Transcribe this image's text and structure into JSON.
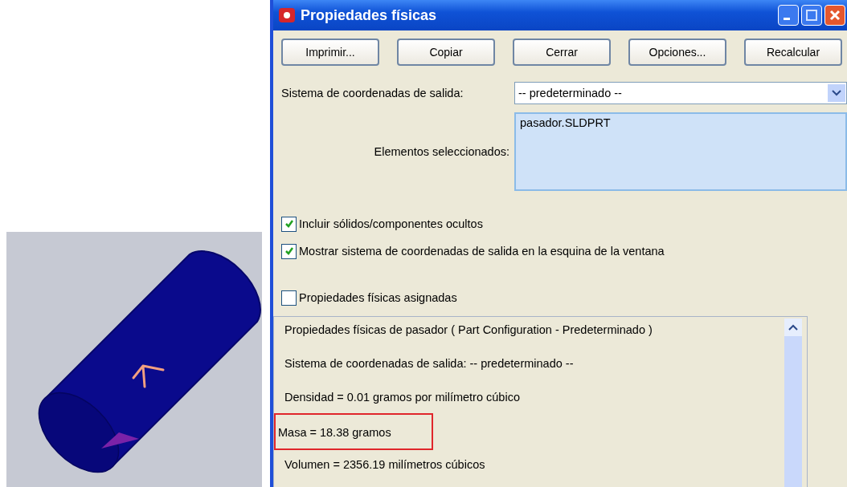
{
  "window": {
    "title": "Propiedades físicas"
  },
  "buttons": [
    {
      "label": "Imprimir..."
    },
    {
      "label": "Copiar"
    },
    {
      "label": "Cerrar"
    },
    {
      "label": "Opciones..."
    },
    {
      "label": "Recalcular"
    }
  ],
  "coordinate_system": {
    "label": "Sistema de coordenadas de salida:",
    "value": "-- predeterminado --"
  },
  "selected_items": {
    "label": "Elementos seleccionados:",
    "value": "pasador.SLDPRT"
  },
  "options": [
    {
      "label": "Incluir sólidos/componentes ocultos",
      "checked": true
    },
    {
      "label": "Mostrar sistema de coordenadas de salida en la esquina de la ventana",
      "checked": true
    },
    {
      "label": "Propiedades físicas asignadas",
      "checked": false
    }
  ],
  "results": [
    {
      "text": "Propiedades físicas de pasador ( Part Configuration - Predeterminado )",
      "highlighted": false
    },
    {
      "text": "Sistema de coordenadas de salida: -- predeterminado --",
      "highlighted": false
    },
    {
      "text": "Densidad = 0.01 gramos por  milímetro cúbico",
      "highlighted": false
    },
    {
      "text": "Masa = 18.38 gramos",
      "highlighted": true
    },
    {
      "text": "Volumen = 2356.19  milímetros cúbicos",
      "highlighted": false
    }
  ]
}
